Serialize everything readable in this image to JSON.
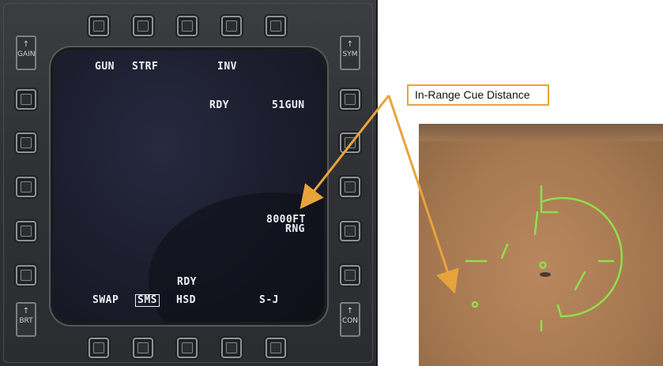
{
  "mfd": {
    "labels": {
      "gun": "GUN",
      "strf": "STRF",
      "inv": "INV",
      "rdy_top": "RDY",
      "gun_count": "51GUN",
      "range_value": "8000FT",
      "range_unit": "RNG",
      "rdy_bottom": "RDY",
      "swap": "SWAP",
      "sms": "SMS",
      "hsd": "HSD",
      "sj": "S-J"
    },
    "rockers": {
      "gain": "GAIN",
      "sym": "SYM",
      "brt": "BRT",
      "con": "CON"
    }
  },
  "callout": {
    "text": "In-Range Cue Distance",
    "color": "#e8a43a"
  },
  "hud": {
    "symbol_color": "#8fe04a"
  }
}
